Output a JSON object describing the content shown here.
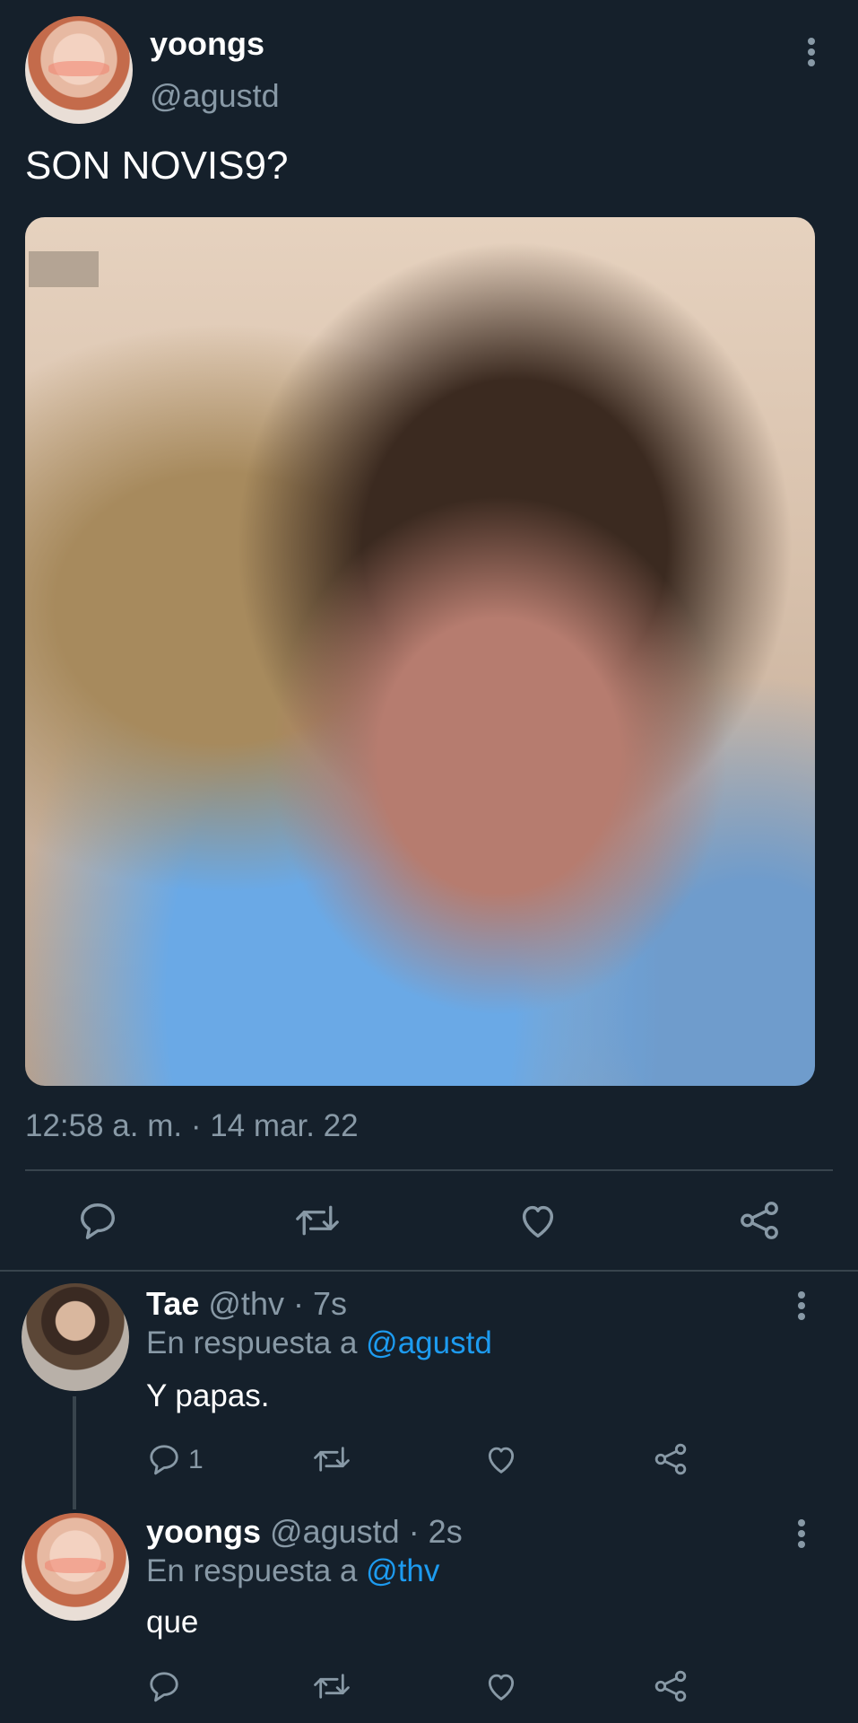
{
  "main_tweet": {
    "display_name": "yoongs",
    "handle": "@agustd",
    "text": "SON NOVIS9?",
    "timestamp": "12:58 a. m. · 14 mar. 22"
  },
  "replies": [
    {
      "display_name": "Tae",
      "handle": "@thv",
      "time": "· 7s",
      "reply_to_prefix": "En respuesta a",
      "reply_to": "@agustd",
      "text": "Y papas.",
      "reply_count": "1"
    },
    {
      "display_name": "yoongs",
      "handle": "@agustd",
      "time": "· 2s",
      "reply_to_prefix": "En respuesta a",
      "reply_to": "@thv",
      "text": "que",
      "reply_count": ""
    }
  ],
  "icons": {
    "reply": "speech-bubble-icon",
    "retweet": "retweet-icon",
    "like": "heart-icon",
    "share": "share-icon",
    "menu": "more-vertical-icon"
  },
  "colors": {
    "background": "#15202b",
    "muted": "#8899a6",
    "link": "#1d9bf0",
    "divider": "#38444d"
  }
}
